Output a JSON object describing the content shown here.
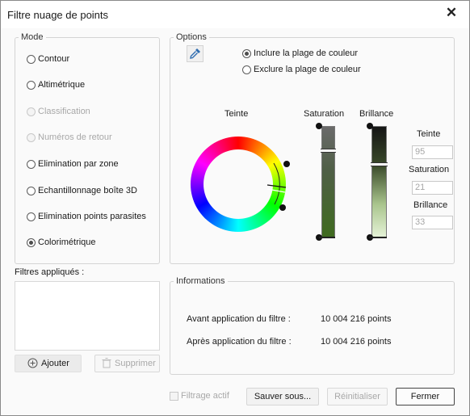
{
  "window": {
    "title": "Filtre nuage de points",
    "close_glyph": "✕"
  },
  "mode": {
    "label": "Mode",
    "options": [
      {
        "label": "Contour",
        "state": "enabled"
      },
      {
        "label": "Altimétrique",
        "state": "enabled"
      },
      {
        "label": "Classification",
        "state": "disabled"
      },
      {
        "label": "Numéros de retour",
        "state": "disabled"
      },
      {
        "label": "Elimination par zone",
        "state": "enabled"
      },
      {
        "label": "Echantillonnage boîte 3D",
        "state": "enabled"
      },
      {
        "label": "Elimination points parasites",
        "state": "enabled"
      },
      {
        "label": "Colorimétrique",
        "state": "checked"
      }
    ]
  },
  "options": {
    "label": "Options",
    "picker_icon": "eyedropper-icon",
    "include_label": "Inclure la plage de couleur",
    "exclude_label": "Exclure la plage de couleur",
    "selected": "include",
    "hue_heading": "Teinte",
    "saturation_heading": "Saturation",
    "brightness_heading": "Brillance",
    "hue_field_label": "Teinte",
    "hue_value": "95",
    "saturation_field_label": "Saturation",
    "saturation_value": "21",
    "brightness_field_label": "Brillance",
    "brightness_value": "33"
  },
  "filters": {
    "label": "Filtres appliqués :",
    "add_label": "Ajouter",
    "remove_label": "Supprimer"
  },
  "info": {
    "label": "Informations",
    "before_label": "Avant application du filtre :",
    "before_value": "10 004 216 points",
    "after_label": "Après application du filtre :",
    "after_value": "10 004 216 points"
  },
  "footer": {
    "active_filter_label": "Filtrage actif",
    "save_as_label": "Sauver sous...",
    "reset_label": "Réinitialiser",
    "close_label": "Fermer"
  },
  "colors": {
    "accent": "#1f5a96",
    "slider_dark": "#1e1e1e",
    "slider_green": "#3f6b1f",
    "slider_light": "#e6f3d8"
  }
}
